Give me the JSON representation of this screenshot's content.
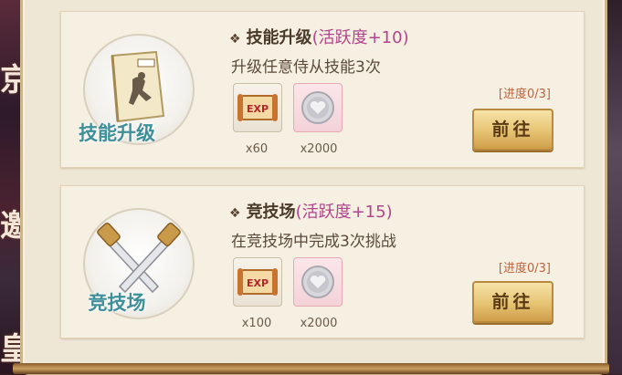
{
  "background": {
    "side_text": [
      "京",
      "邀",
      "皇"
    ]
  },
  "tasks": [
    {
      "emblem_label": "技能升级",
      "emblem_icon": "book-icon",
      "title": "技能升级",
      "bonus": "(活跃度+10)",
      "description": "升级任意侍从技能3次",
      "rewards": [
        {
          "icon": "exp-scroll-icon",
          "quantity": "x60"
        },
        {
          "icon": "silver-coin-icon",
          "quantity": "x2000"
        }
      ],
      "progress": "[进度0/3]",
      "button_label": "前往"
    },
    {
      "emblem_label": "竞技场",
      "emblem_icon": "crossed-swords-icon",
      "title": "竞技场",
      "bonus": "(活跃度+15)",
      "description": "在竞技场中完成3次挑战",
      "rewards": [
        {
          "icon": "exp-scroll-icon",
          "quantity": "x100"
        },
        {
          "icon": "silver-coin-icon",
          "quantity": "x2000"
        }
      ],
      "progress": "[进度0/3]",
      "button_label": "前往"
    }
  ],
  "colors": {
    "bonus": "#b0458c",
    "emblem_label": "#3f8f9a",
    "progress": "#c0613a",
    "button": "#e6c372"
  }
}
